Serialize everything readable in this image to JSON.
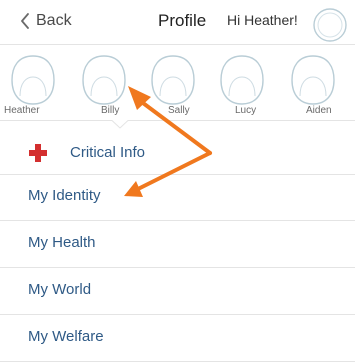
{
  "navbar": {
    "back_label": "Back",
    "title": "Profile",
    "greeting": "Hi Heather!"
  },
  "members": [
    {
      "name": "Heather"
    },
    {
      "name": "Billy"
    },
    {
      "name": "Sally"
    },
    {
      "name": "Lucy"
    },
    {
      "name": "Aiden"
    }
  ],
  "menu": {
    "critical_info": "Critical Info",
    "items": [
      {
        "label": "My Identity"
      },
      {
        "label": "My Health"
      },
      {
        "label": "My World"
      },
      {
        "label": "My Welfare"
      }
    ]
  },
  "colors": {
    "accent_blue": "#2f5a86",
    "avatar_outline": "#b9cdd6",
    "cross_red": "#d32f2f",
    "annotation_orange": "#f0781e"
  },
  "icons": {
    "back": "chevron-left-icon",
    "critical": "red-cross-icon",
    "avatar": "person-outline-icon"
  }
}
